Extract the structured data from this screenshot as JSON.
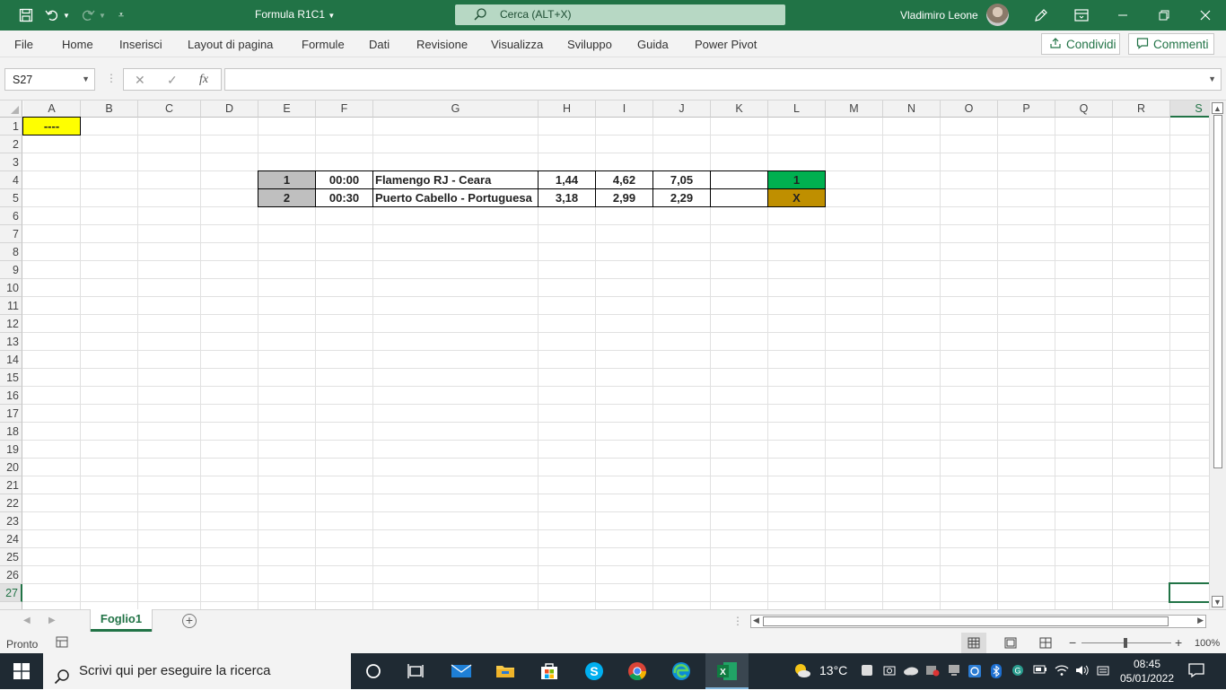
{
  "titlebar": {
    "title": "Formula R1C1",
    "search_placeholder": "Cerca (ALT+X)",
    "user": "Vladimiro Leone",
    "bg_color": "#217346"
  },
  "ribbon": {
    "tabs": [
      "File",
      "Home",
      "Inserisci",
      "Layout di pagina",
      "Formule",
      "Dati",
      "Revisione",
      "Visualizza",
      "Sviluppo",
      "Guida",
      "Power Pivot"
    ],
    "share_label": "Condividi",
    "comments_label": "Commenti"
  },
  "formula_bar": {
    "name_box": "S27",
    "fx": "fx",
    "value": ""
  },
  "grid": {
    "columns": [
      "A",
      "B",
      "C",
      "D",
      "E",
      "F",
      "G",
      "H",
      "I",
      "J",
      "K",
      "L",
      "M",
      "N",
      "O",
      "P",
      "Q",
      "R",
      "S"
    ],
    "rows": [
      "1",
      "2",
      "3",
      "4",
      "5",
      "6",
      "7",
      "8",
      "9",
      "10",
      "11",
      "12",
      "13",
      "14",
      "15",
      "16",
      "17",
      "18",
      "19",
      "20",
      "21",
      "22",
      "23",
      "24",
      "25",
      "26",
      "27"
    ],
    "selected_col": "S",
    "selected_row": "27",
    "cells": {
      "A1": "----",
      "E4": "1",
      "F4": "00:00",
      "G4": "Flamengo RJ - Ceara",
      "H4": "1,44",
      "I4": "4,62",
      "J4": "7,05",
      "K4": "",
      "L4": "1",
      "E5": "2",
      "F5": "00:30",
      "G5": "Puerto Cabello - Portuguesa",
      "H5": "3,18",
      "I5": "2,99",
      "J5": "2,29",
      "K5": "",
      "L5": "X"
    },
    "colors": {
      "a1_fill": "#ffff00",
      "index_fill": "#bfbfbf",
      "l4_fill": "#00b050",
      "l5_fill": "#bf8f00"
    }
  },
  "sheets": {
    "active": "Foglio1"
  },
  "status": {
    "ready": "Pronto",
    "zoom": "100%"
  },
  "taskbar": {
    "search_placeholder": "Scrivi qui per eseguire la ricerca",
    "temperature": "13°C",
    "time": "08:45",
    "date": "05/01/2022"
  }
}
